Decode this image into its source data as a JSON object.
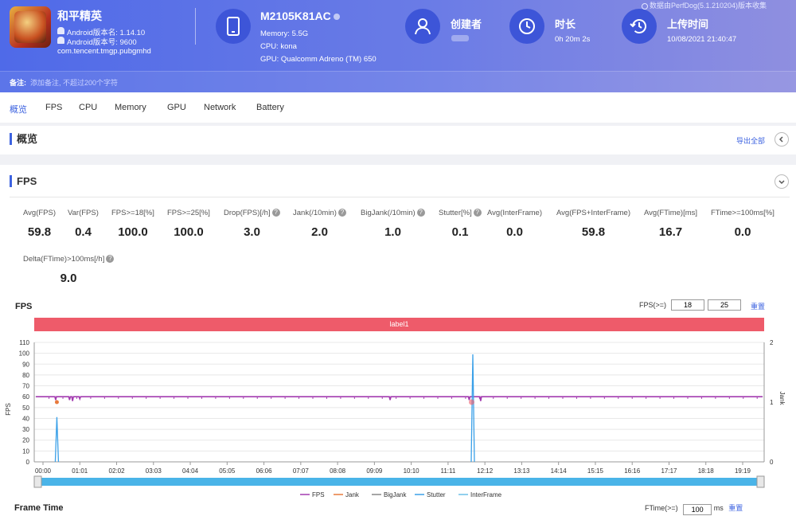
{
  "header": {
    "app_name": "和平精英",
    "android_version_name": "Android版本名: 1.14.10",
    "android_version_code": "Android版本号: 9600",
    "package": "com.tencent.tmgp.pubgmhd",
    "device_model": "M2105K81AC",
    "memory": "Memory: 5.5G",
    "cpu": "CPU: kona",
    "gpu": "GPU: Qualcomm Adreno (TM) 650",
    "creator_label": "创建者",
    "duration_label": "时长",
    "duration_value": "0h 20m 2s",
    "upload_label": "上传时间",
    "upload_value": "10/08/2021 21:40:47",
    "source_note": "数据由PerfDog(5.1.210204)版本收集",
    "note_label": "备注:",
    "note_placeholder": "添加备注, 不超过200个字符"
  },
  "tabs": [
    "概览",
    "FPS",
    "CPU",
    "Memory",
    "GPU",
    "Network",
    "Battery"
  ],
  "overview": {
    "title": "概览",
    "export_label": "导出全部"
  },
  "fps_section": {
    "title": "FPS",
    "stats": [
      {
        "label": "Avg(FPS)",
        "value": "59.8",
        "help": false
      },
      {
        "label": "Var(FPS)",
        "value": "0.4",
        "help": false
      },
      {
        "label": "FPS>=18[%]",
        "value": "100.0",
        "help": false
      },
      {
        "label": "FPS>=25[%]",
        "value": "100.0",
        "help": false
      },
      {
        "label": "Drop(FPS)[/h]",
        "value": "3.0",
        "help": true
      },
      {
        "label": "Jank(/10min)",
        "value": "2.0",
        "help": true
      },
      {
        "label": "BigJank(/10min)",
        "value": "1.0",
        "help": true
      },
      {
        "label": "Stutter[%]",
        "value": "0.1",
        "help": true
      },
      {
        "label": "Avg(InterFrame)",
        "value": "0.0",
        "help": false
      },
      {
        "label": "Avg(FPS+InterFrame)",
        "value": "59.8",
        "help": false
      },
      {
        "label": "Avg(FTime)[ms]",
        "value": "16.7",
        "help": false
      },
      {
        "label": "FTime>=100ms[%]",
        "value": "0.0",
        "help": false
      },
      {
        "label": "Delta(FTime)>100ms[/h]",
        "value": "9.0",
        "help": true
      }
    ]
  },
  "fps_chart": {
    "title": "FPS",
    "threshold_label": "FPS(>=)",
    "threshold_1": "18",
    "threshold_2": "25",
    "reset_label": "重置",
    "marker_label": "label1",
    "y_label": "FPS",
    "y2_label": "Jank",
    "legend": [
      "FPS",
      "Jank",
      "BigJank",
      "Stutter",
      "InterFrame"
    ]
  },
  "frame_time": {
    "title": "Frame Time",
    "ctrl_label": "FTime(>=)",
    "ctrl_value": "100",
    "ctrl_unit": "ms",
    "reset_label": "重置"
  },
  "colors": {
    "accent": "#3d63e0",
    "fps_line": "#a33cb0",
    "jank": "#e87a3c",
    "stutter": "#3aa0e8",
    "marker_bar": "#ee5b6a"
  },
  "chart_data": {
    "type": "line",
    "x_ticks": [
      "00:00",
      "01:01",
      "02:02",
      "03:03",
      "04:04",
      "05:05",
      "06:06",
      "07:07",
      "08:08",
      "09:09",
      "10:10",
      "11:11",
      "12:12",
      "13:13",
      "14:14",
      "15:15",
      "16:16",
      "17:17",
      "18:18",
      "19:19"
    ],
    "y_ticks": [
      0,
      10,
      20,
      30,
      40,
      50,
      60,
      70,
      80,
      90,
      100,
      110
    ],
    "y2_ticks": [
      0,
      1,
      2
    ],
    "ylim": [
      0,
      110
    ],
    "y2lim": [
      0,
      2
    ],
    "series": [
      {
        "name": "FPS",
        "values_note": "steady",
        "baseline": 60,
        "dips": [
          {
            "x": "00:21",
            "y": 57
          },
          {
            "x": "00:44",
            "y": 57
          },
          {
            "x": "00:49",
            "y": 56
          },
          {
            "x": "01:01",
            "y": 58
          },
          {
            "x": "09:35",
            "y": 57
          },
          {
            "x": "11:46",
            "y": 57
          },
          {
            "x": "12:05",
            "y": 56
          }
        ]
      },
      {
        "name": "Jank",
        "events": [
          {
            "x": "00:23",
            "y": 1
          }
        ]
      },
      {
        "name": "BigJank",
        "events": [
          {
            "x": "11:50",
            "y": 1
          }
        ]
      },
      {
        "name": "Stutter",
        "spikes": [
          {
            "x": "00:23",
            "y": 0.75
          },
          {
            "x": "11:52",
            "y": 1.8
          }
        ]
      }
    ]
  }
}
